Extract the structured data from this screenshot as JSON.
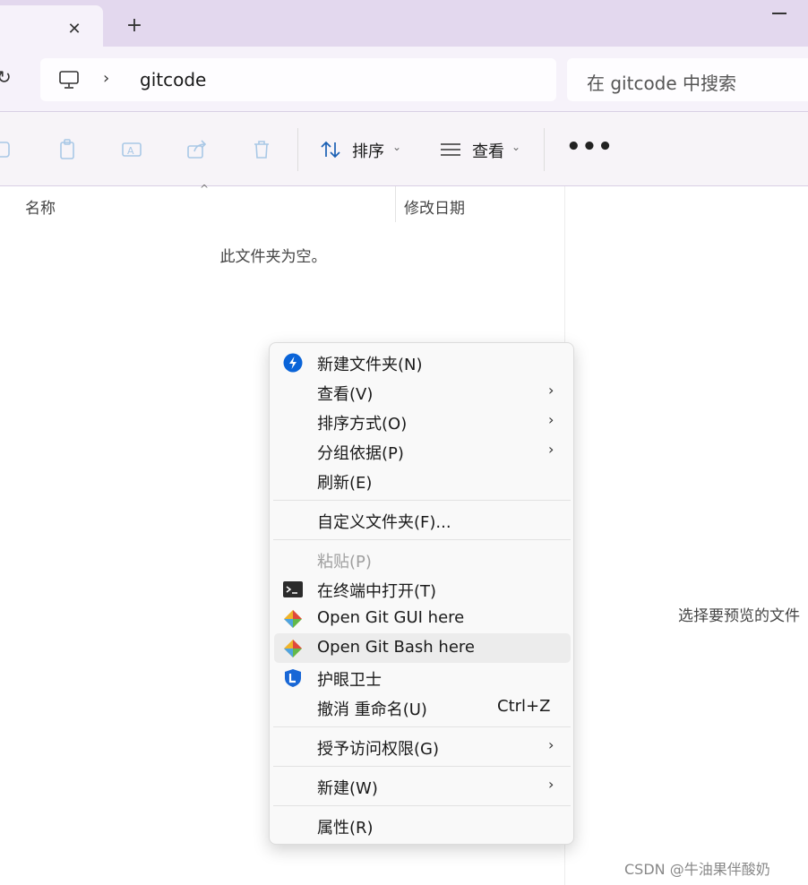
{
  "window": {
    "tab_close": "✕",
    "new_tab": "+"
  },
  "addressbar": {
    "refresh_icon": "refresh-icon",
    "chevron": "›",
    "folder": "gitcode",
    "search_placeholder": "在 gitcode 中搜索"
  },
  "toolbar": {
    "sort_label": "排序",
    "view_label": "查看",
    "more": "•••",
    "caret": "⌄"
  },
  "filelist": {
    "col_name": "名称",
    "col_modified": "修改日期",
    "sort_arrow": "^",
    "empty_message": "此文件夹为空。"
  },
  "preview": {
    "message": "选择要预览的文件"
  },
  "context_menu": {
    "items": [
      {
        "label": "新建文件夹(N)",
        "icon": "new-folder-icon"
      },
      {
        "label": "查看(V)",
        "submenu": true
      },
      {
        "label": "排序方式(O)",
        "submenu": true
      },
      {
        "label": "分组依据(P)",
        "submenu": true
      },
      {
        "label": "刷新(E)"
      },
      {
        "label": "自定义文件夹(F)..."
      },
      {
        "label": "粘贴(P)",
        "disabled": true
      },
      {
        "label": "在终端中打开(T)",
        "icon": "terminal-icon"
      },
      {
        "label": "Open Git GUI here",
        "icon": "git-icon"
      },
      {
        "label": "Open Git Bash here",
        "icon": "git-icon",
        "highlighted": true
      },
      {
        "label": "护眼卫士",
        "icon": "eye-guard-icon"
      },
      {
        "label": "撤消 重命名(U)",
        "shortcut": "Ctrl+Z"
      },
      {
        "label": "授予访问权限(G)",
        "submenu": true
      },
      {
        "label": "新建(W)",
        "submenu": true
      },
      {
        "label": "属性(R)"
      }
    ],
    "submenu_arrow": "›"
  },
  "watermark": "CSDN @牛油果伴酸奶",
  "colors": {
    "tabstrip": "#e3d8ee",
    "address_row": "#f6f2fa",
    "menu_bg": "#f9f9f9",
    "menu_hover": "#ececec",
    "accent": "#0a64d8"
  }
}
